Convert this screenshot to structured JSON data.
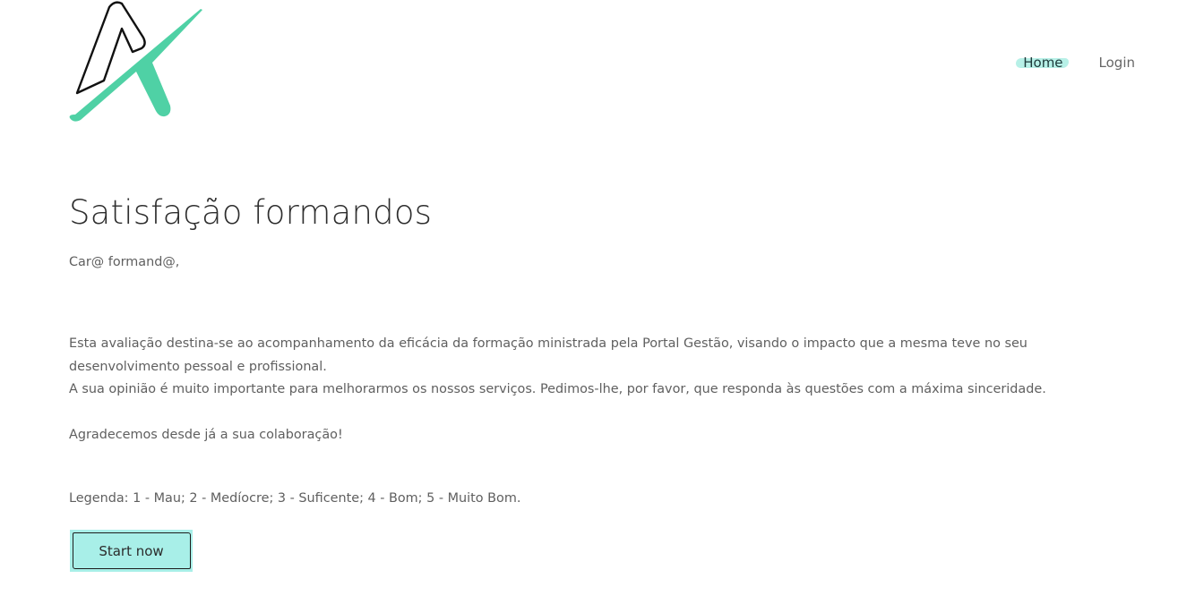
{
  "brand": {
    "logo_icon": "stylized-a-logo-icon",
    "colors": {
      "accent": "#4fd1a5",
      "button_fill": "#a8efe8",
      "nav_highlight": "#b7f0e7"
    }
  },
  "nav": {
    "home_label": "Home",
    "login_label": "Login"
  },
  "main": {
    "title": "Satisfação formandos",
    "greeting": "Car@ formand@,",
    "paragraph1": "Esta avaliação destina-se ao acompanhamento da eficácia da formação ministrada pela Portal Gestão, visando o impacto que a mesma teve no seu desenvolvimento pessoal e profissional.",
    "paragraph2": "A sua opinião é muito importante para melhorarmos os nossos serviços. Pedimos-lhe, por favor, que responda às questões com a máxima sinceridade.",
    "thanks": "Agradecemos desde já a sua colaboração!",
    "legend": "Legenda: 1 - Mau; 2 - Medíocre; 3 - Suficente; 4 - Bom; 5 - Muito Bom.",
    "start_button_label": "Start now"
  }
}
